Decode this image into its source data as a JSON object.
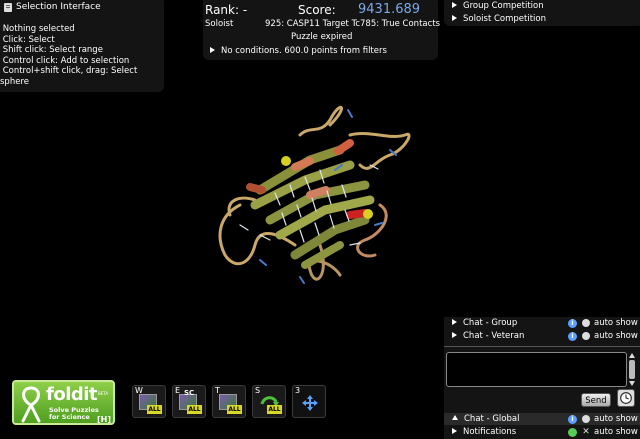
{
  "selection": {
    "title": "Selection Interface",
    "lines": [
      " Nothing selected",
      " Click: Select",
      " Shift click: Select range",
      " Control click: Add to selection",
      " Control+shift click, drag: Select",
      "sphere"
    ]
  },
  "score": {
    "rank_label": "Rank: -",
    "score_label": "Score:",
    "score_value": "9431.689",
    "mode": "Soloist",
    "puzzle_title": "925: CASP11 Target Tc785: True Contacts",
    "status": "Puzzle expired",
    "conditions": "No conditions. 600.0 points from filters"
  },
  "competition": {
    "items": [
      "Group Competition",
      "Soloist Competition"
    ]
  },
  "chat": {
    "group": "Chat - Group",
    "veteran": "Chat - Veteran",
    "global": "Chat - Global",
    "notifications": "Notifications",
    "auto_show": "auto show",
    "send": "Send",
    "info_glyph": "i"
  },
  "logo": {
    "word": "foldit",
    "beta": "BETA",
    "tagline_1": "Solve Puzzles",
    "tagline_2": "for Science",
    "hotkey": "[H]"
  },
  "tools": [
    {
      "key": "W",
      "badge": "ALL",
      "sub": ""
    },
    {
      "key": "E",
      "badge": "ALL",
      "sub": "SC"
    },
    {
      "key": "T",
      "badge": "ALL",
      "sub": ""
    },
    {
      "key": "S",
      "badge": "ALL",
      "sub": ""
    },
    {
      "key": "3",
      "badge": "",
      "sub": ""
    }
  ],
  "colors": {
    "score_value": "#7aa9e8",
    "panel_bg": "#141414",
    "logo_green": "#6fbf35",
    "badge_yellow": "#d8d82a"
  }
}
